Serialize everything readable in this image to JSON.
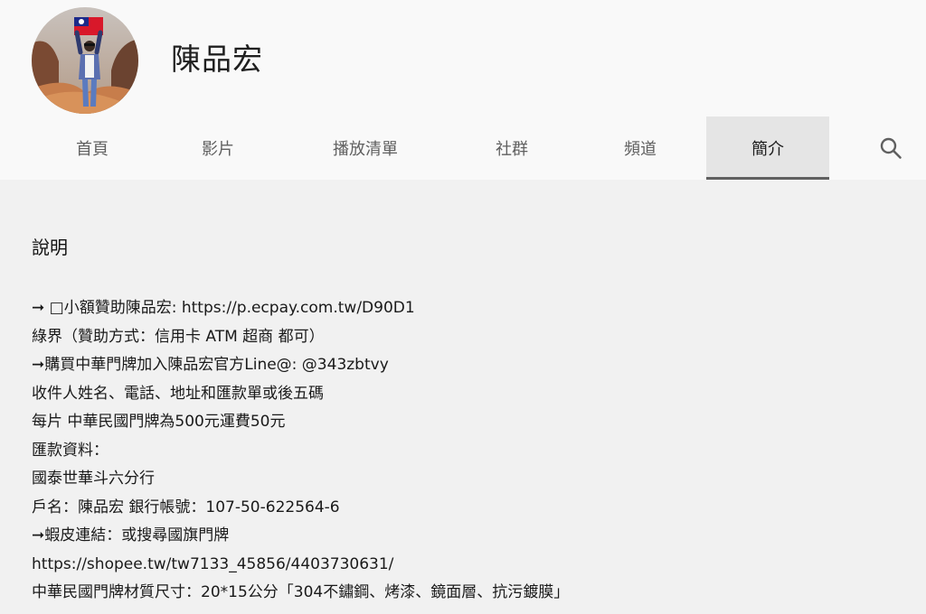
{
  "channel": {
    "name": "陳品宏"
  },
  "tabs": [
    {
      "label": "首頁",
      "active": false
    },
    {
      "label": "影片",
      "active": false
    },
    {
      "label": "播放清單",
      "active": false
    },
    {
      "label": "社群",
      "active": false
    },
    {
      "label": "頻道",
      "active": false
    },
    {
      "label": "簡介",
      "active": true
    }
  ],
  "search": {
    "icon": "search-icon"
  },
  "about": {
    "section_title": "說明",
    "lines": [
      {
        "arrow": "➞",
        "text": " □小額贊助陳品宏: https://p.ecpay.com.tw/D90D1"
      },
      {
        "arrow": "",
        "text": "綠界（贊助方式：信用卡 ATM 超商 都可）"
      },
      {
        "arrow": "➞",
        "text": "購買中華門牌加入陳品宏官方Line@: @343zbtvy"
      },
      {
        "arrow": "",
        "text": "收件人姓名、電話、地址和匯款單或後五碼"
      },
      {
        "arrow": "",
        "text": "每片 中華民國門牌為500元運費50元"
      },
      {
        "arrow": "",
        "text": "匯款資料："
      },
      {
        "arrow": "",
        "text": "國泰世華斗六分行"
      },
      {
        "arrow": "",
        "text": "戶名：陳品宏 銀行帳號：107-50-622564-6"
      },
      {
        "arrow": "➞",
        "text": "蝦皮連結：或搜尋國旗門牌"
      },
      {
        "arrow": "",
        "text": "https://shopee.tw/tw7133_45856/4403730631/"
      },
      {
        "arrow": "",
        "text": "中華民國門牌材質尺寸：20*15公分「304不鏽鋼、烤漆、鏡面層、抗污鍍膜」"
      }
    ]
  },
  "colors": {
    "header_bg": "#f9f9f9",
    "page_bg": "#f1f1f1",
    "active_tab_bg": "#e5e5e5",
    "active_tab_underline": "#606060"
  }
}
